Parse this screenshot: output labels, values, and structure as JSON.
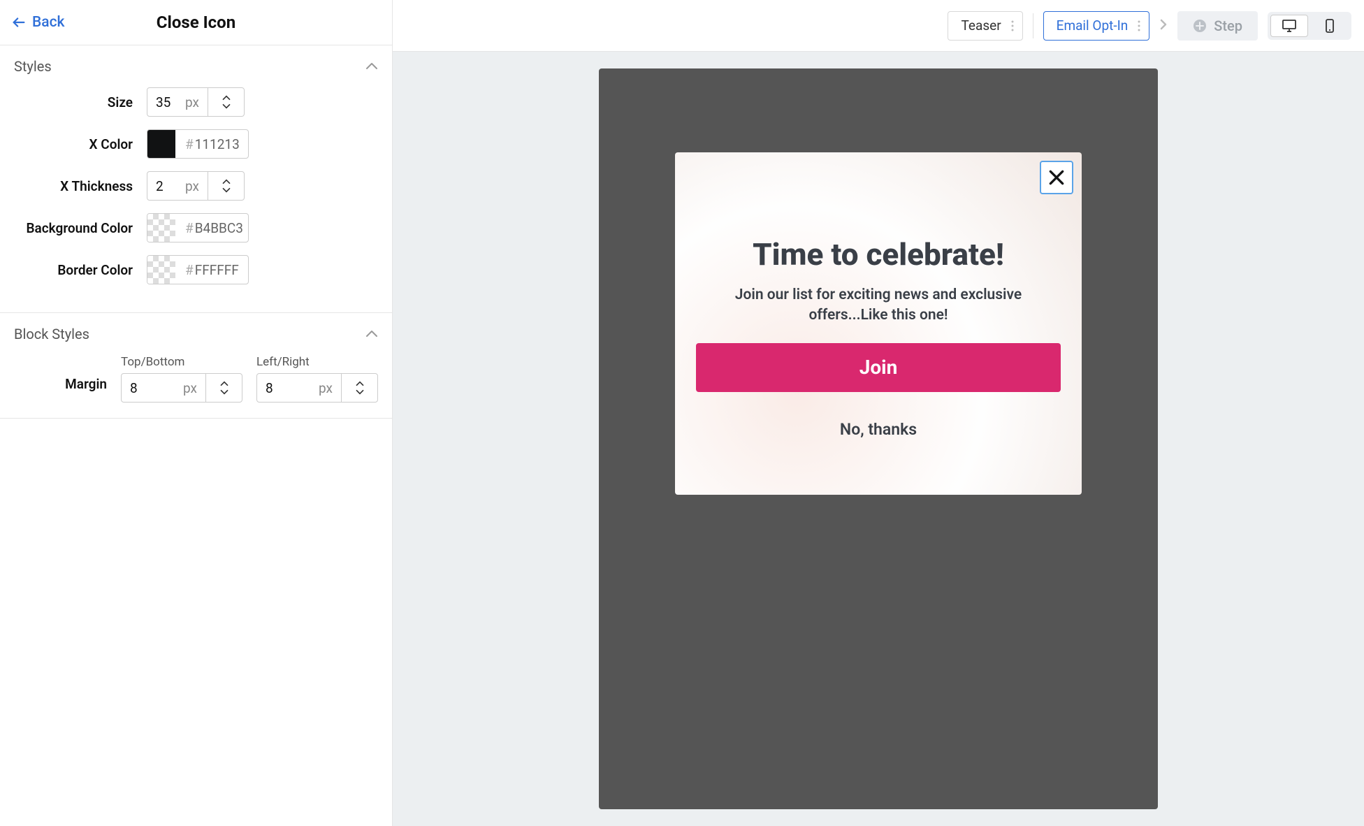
{
  "sidebar": {
    "back_label": "Back",
    "title": "Close Icon",
    "sections": {
      "styles": {
        "title": "Styles",
        "fields": {
          "size": {
            "label": "Size",
            "value": "35",
            "unit": "px"
          },
          "x_color": {
            "label": "X Color",
            "value": "111213"
          },
          "x_thickness": {
            "label": "X Thickness",
            "value": "2",
            "unit": "px"
          },
          "bg_color": {
            "label": "Background Color",
            "value": "B4BBC3"
          },
          "border_color": {
            "label": "Border Color",
            "value": "FFFFFF"
          }
        }
      },
      "block_styles": {
        "title": "Block Styles",
        "margin": {
          "label": "Margin",
          "tb_label": "Top/Bottom",
          "tb_value": "8",
          "tb_unit": "px",
          "lr_label": "Left/Right",
          "lr_value": "8",
          "lr_unit": "px"
        }
      }
    }
  },
  "topbar": {
    "teaser": "Teaser",
    "email_optin": "Email Opt-In",
    "add_step": "Step"
  },
  "popup": {
    "title": "Time to celebrate!",
    "subtitle": "Join our list for exciting news and exclusive offers...Like this one!",
    "cta": "Join",
    "decline": "No, thanks"
  }
}
